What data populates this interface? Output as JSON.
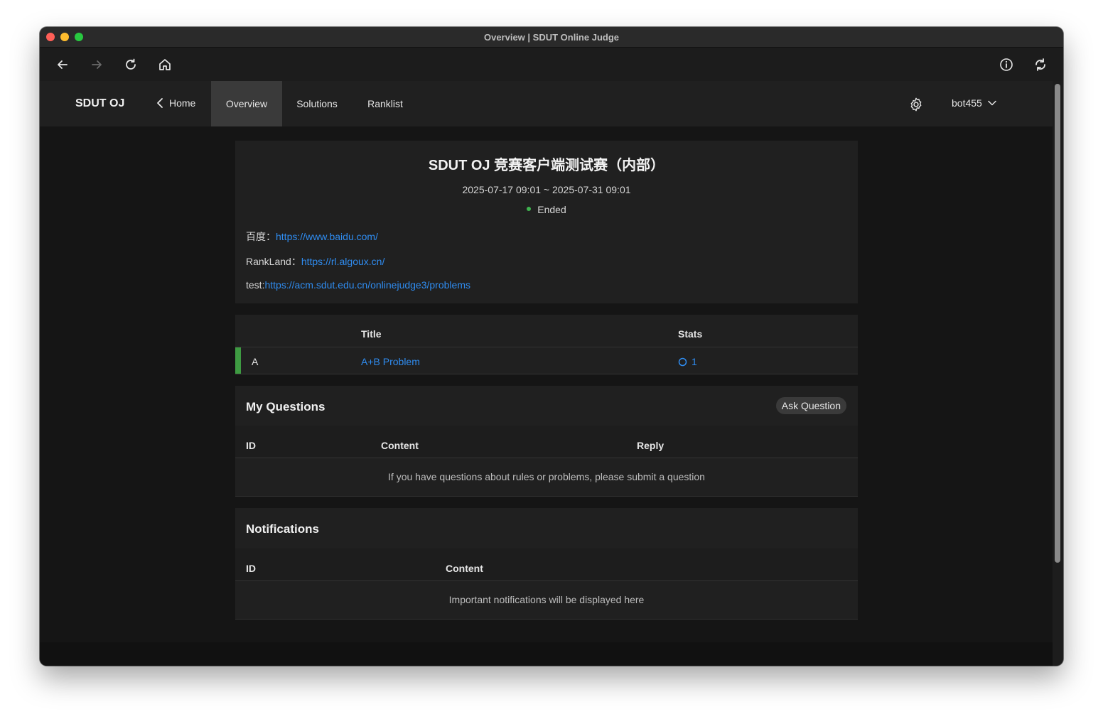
{
  "window": {
    "title": "Overview | SDUT Online Judge"
  },
  "toolbar": {
    "back_icon": "arrow-left-icon",
    "forward_icon": "arrow-right-icon",
    "reload_icon": "reload-icon",
    "home_icon": "home-icon",
    "info_icon": "info-icon",
    "sync_icon": "sync-icon"
  },
  "nav": {
    "brand": "SDUT OJ",
    "home": "Home",
    "tabs": [
      {
        "label": "Overview",
        "active": true
      },
      {
        "label": "Solutions",
        "active": false
      },
      {
        "label": "Ranklist",
        "active": false
      }
    ],
    "user": "bot455"
  },
  "contest": {
    "title": "SDUT OJ 竞赛客户端测试赛（内部）",
    "time": "2025-07-17 09:01 ~ 2025-07-31 09:01",
    "status": "Ended",
    "status_color": "#3fb34f",
    "desc": [
      {
        "label": "百度：",
        "link": "https://www.baidu.com/"
      },
      {
        "label": "RankLand：",
        "link": "https://rl.algoux.cn/"
      },
      {
        "label": "test:",
        "link": "https://acm.sdut.edu.cn/onlinejudge3/problems"
      }
    ]
  },
  "problems": {
    "headers": {
      "title": "Title",
      "stats": "Stats"
    },
    "rows": [
      {
        "index": "A",
        "title": "A+B Problem",
        "stats": "1",
        "accent": "#3e9b42"
      }
    ]
  },
  "questions": {
    "title": "My Questions",
    "ask_button": "Ask Question",
    "headers": {
      "id": "ID",
      "content": "Content",
      "reply": "Reply"
    },
    "empty": "If you have questions about rules or problems, please submit a question"
  },
  "notifications": {
    "title": "Notifications",
    "headers": {
      "id": "ID",
      "content": "Content"
    },
    "empty": "Important notifications will be displayed here"
  },
  "colors": {
    "link": "#2f8cf0",
    "accent_green": "#3e9b42"
  }
}
